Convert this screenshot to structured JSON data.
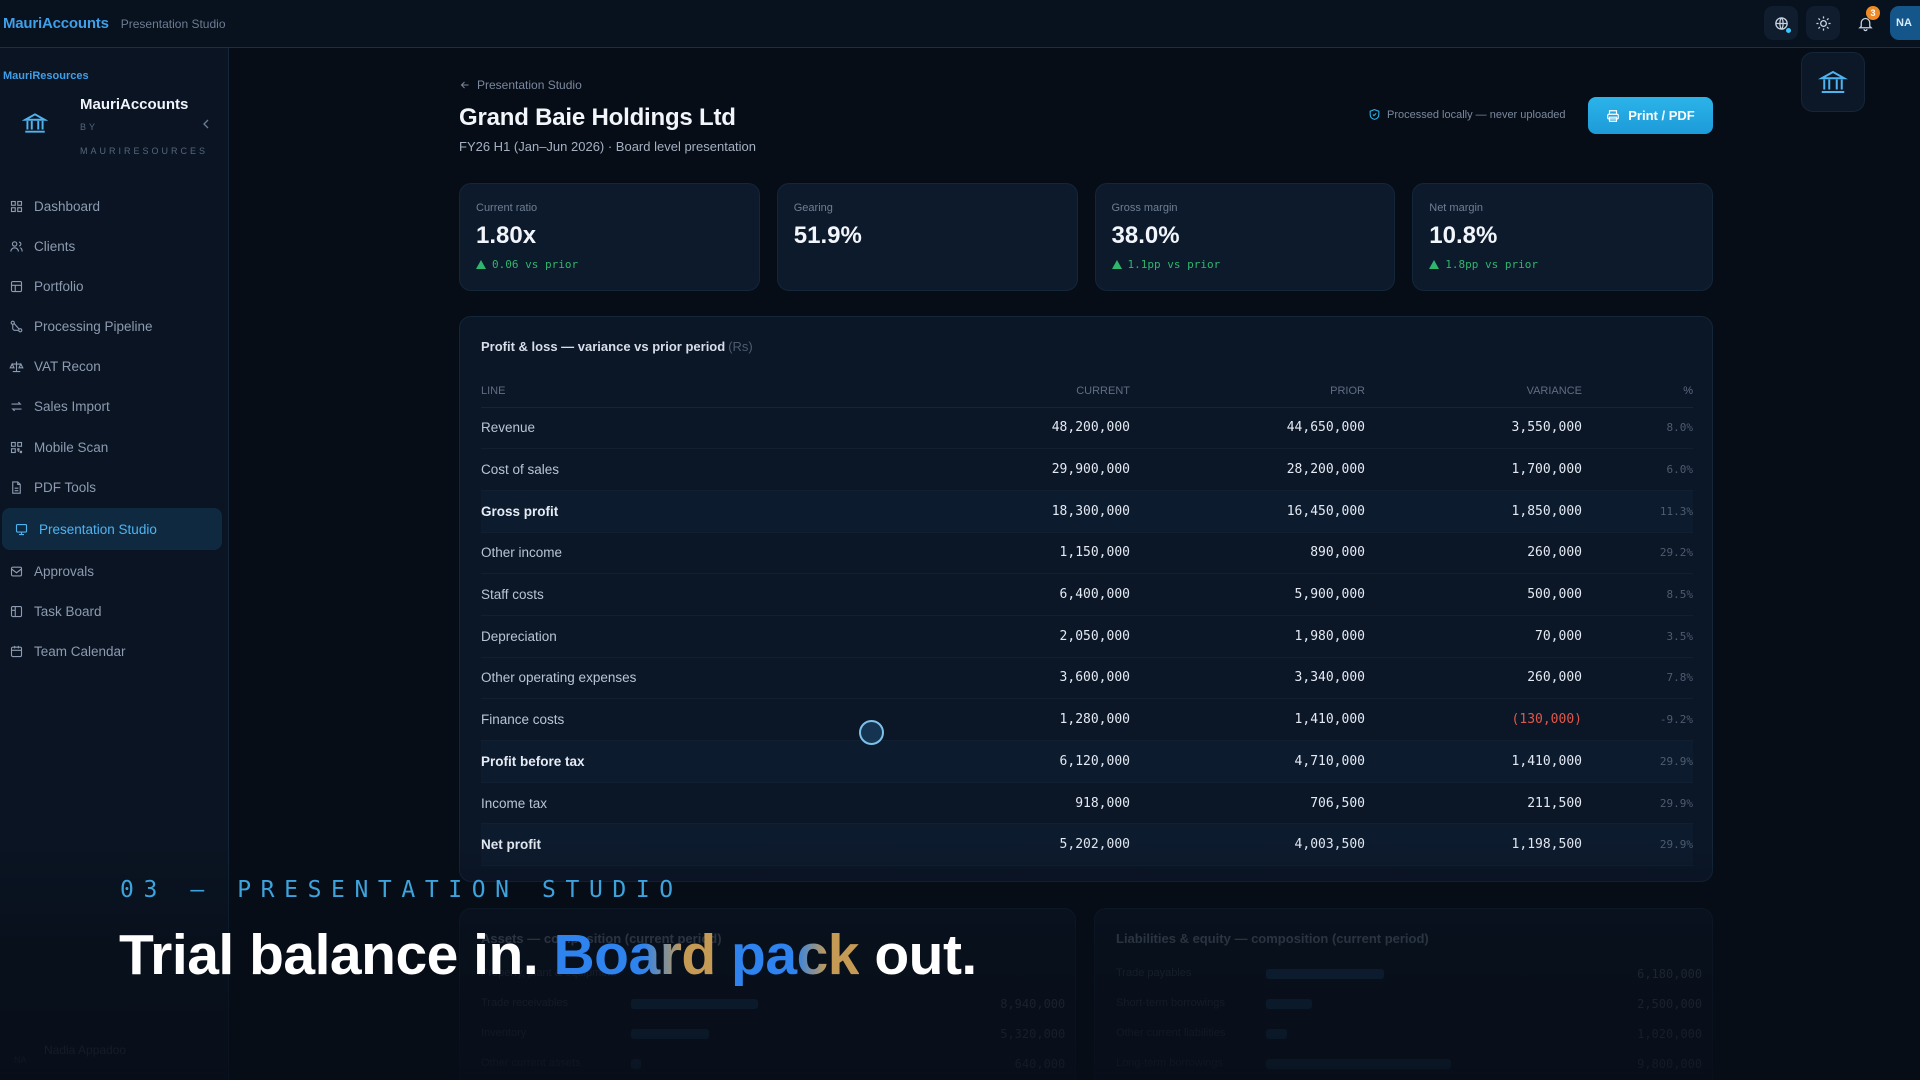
{
  "topbar": {
    "brand": "MauriAccounts",
    "section": "Presentation Studio",
    "notification_count": "3",
    "user_initials": "NA"
  },
  "sidebar": {
    "org_label": "MauriResources",
    "org_name": "MauriAccounts",
    "org_by": "BY",
    "org_by_name": "MAURIRESOURCES",
    "items": [
      {
        "label": "Dashboard",
        "icon": "grid-icon"
      },
      {
        "label": "Clients",
        "icon": "users-icon"
      },
      {
        "label": "Portfolio",
        "icon": "folder-icon"
      },
      {
        "label": "Processing Pipeline",
        "icon": "pipeline-icon"
      },
      {
        "label": "VAT Recon",
        "icon": "scale-icon"
      },
      {
        "label": "Sales Import",
        "icon": "arrows-icon"
      },
      {
        "label": "Mobile Scan",
        "icon": "scan-icon"
      },
      {
        "label": "PDF Tools",
        "icon": "file-icon"
      },
      {
        "label": "Presentation Studio",
        "icon": "monitor-icon",
        "active": true
      },
      {
        "label": "Approvals",
        "icon": "check-icon"
      },
      {
        "label": "Task Board",
        "icon": "board-icon"
      },
      {
        "label": "Team Calendar",
        "icon": "calendar-icon"
      }
    ],
    "user_name": "Nadia Appadoo"
  },
  "header": {
    "back_label": "Presentation Studio",
    "title": "Grand Baie Holdings Ltd",
    "subtitle": "FY26 H1 (Jan–Jun 2026) · Board level presentation",
    "local_note": "Processed locally — never uploaded",
    "print_label": "Print / PDF"
  },
  "kpis": [
    {
      "label": "Current ratio",
      "value": "1.80x",
      "delta": "0.06 vs prior"
    },
    {
      "label": "Gearing",
      "value": "51.9%",
      "delta": ""
    },
    {
      "label": "Gross margin",
      "value": "38.0%",
      "delta": "1.1pp vs prior"
    },
    {
      "label": "Net margin",
      "value": "10.8%",
      "delta": "1.8pp vs prior"
    }
  ],
  "pl": {
    "title": "Profit & loss — variance vs prior period",
    "unit": "(Rs)",
    "columns": [
      "Line",
      "Current",
      "Prior",
      "Variance",
      "%"
    ],
    "rows": [
      {
        "line": "Revenue",
        "current": "48,200,000",
        "prior": "44,650,000",
        "variance": "3,550,000",
        "pct": "8.0%"
      },
      {
        "line": "Cost of sales",
        "current": "29,900,000",
        "prior": "28,200,000",
        "variance": "1,700,000",
        "pct": "6.0%"
      },
      {
        "line": "Gross profit",
        "current": "18,300,000",
        "prior": "16,450,000",
        "variance": "1,850,000",
        "pct": "11.3%",
        "strong": true
      },
      {
        "line": "Other income",
        "current": "1,150,000",
        "prior": "890,000",
        "variance": "260,000",
        "pct": "29.2%"
      },
      {
        "line": "Staff costs",
        "current": "6,400,000",
        "prior": "5,900,000",
        "variance": "500,000",
        "pct": "8.5%"
      },
      {
        "line": "Depreciation",
        "current": "2,050,000",
        "prior": "1,980,000",
        "variance": "70,000",
        "pct": "3.5%"
      },
      {
        "line": "Other operating expenses",
        "current": "3,600,000",
        "prior": "3,340,000",
        "variance": "260,000",
        "pct": "7.8%"
      },
      {
        "line": "Finance costs",
        "current": "1,280,000",
        "prior": "1,410,000",
        "variance": "(130,000)",
        "pct": "-9.2%",
        "negative": true
      },
      {
        "line": "Profit before tax",
        "current": "6,120,000",
        "prior": "4,710,000",
        "variance": "1,410,000",
        "pct": "29.9%",
        "strong": true
      },
      {
        "line": "Income tax",
        "current": "918,000",
        "prior": "706,500",
        "variance": "211,500",
        "pct": "29.9%"
      },
      {
        "line": "Net profit",
        "current": "5,202,000",
        "prior": "4,003,500",
        "variance": "1,198,500",
        "pct": "29.9%",
        "strong": true
      }
    ]
  },
  "assets": {
    "title": "Assets — composition (current period)",
    "rows": [
      {
        "label": "Property, plant & equipment",
        "value": "",
        "share": 0.0
      },
      {
        "label": "Trade receivables",
        "value": "8,940,000",
        "share": 0.26
      },
      {
        "label": "Inventory",
        "value": "5,320,000",
        "share": 0.16
      },
      {
        "label": "Other current assets",
        "value": "640,000",
        "share": 0.02
      }
    ]
  },
  "liabilities": {
    "title": "Liabilities & equity — composition (current period)",
    "rows": [
      {
        "label": "Trade payables",
        "value": "6,180,000",
        "share": 0.28
      },
      {
        "label": "Short-term borrowings",
        "value": "2,500,000",
        "share": 0.11
      },
      {
        "label": "Other current liabilities",
        "value": "1,020,000",
        "share": 0.05
      },
      {
        "label": "Long-term borrowings",
        "value": "9,800,000",
        "share": 0.44
      }
    ]
  },
  "caption": {
    "kicker": "03 — PRESENTATION STUDIO",
    "part1": "Trial balance in.",
    "board": "Board",
    "pack": "pack",
    "part2": "out."
  },
  "colors": {
    "accent": "#2cb3ea",
    "positive": "#2fb56d",
    "negative": "#e0584a",
    "brand": "#3f9fe8"
  }
}
